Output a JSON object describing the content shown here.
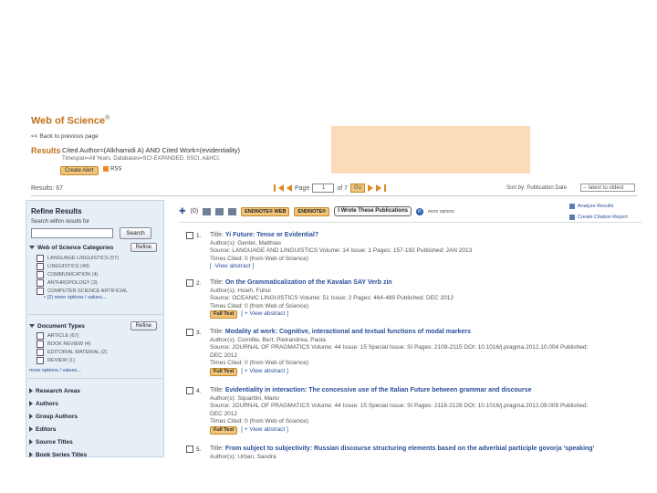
{
  "header": {
    "logo": "Web of Science",
    "logo_sup": "®",
    "back_link": "<< Back to previous page",
    "results_label": "Results",
    "query": "Cited Author=(Alkhamidi A) AND Cited Work=(evidentiality)",
    "query_sub": "Timespan=All Years. Databases=SCI-EXPANDED, SSCI, A&HCI.",
    "create_alert": "Create Alert",
    "rss": "RSS"
  },
  "toolbar_top": {
    "results_count": "Results: 67",
    "page_label": "Page",
    "page_value": "1",
    "page_of": "of 7",
    "go": "Go",
    "sort_by": "Sort by: Publication Date",
    "sort_value": "-- latest to oldest"
  },
  "refine": {
    "title": "Refine Results",
    "search_label": "Search within results for",
    "search_button": "Search",
    "refine_button": "Refine",
    "categories_title": "Web of Science Categories",
    "categories": [
      "LANGUAGE LINGUISTICS (57)",
      "LINGUISTICS (48)",
      "COMMUNICATION (4)",
      "ANTHROPOLOGY (3)",
      "COMPUTER SCIENCE ARTIFICIAL"
    ],
    "categories_more": "• (2) more options / values...",
    "doctypes_title": "Document Types",
    "doctypes": [
      "ARTICLE (67)",
      "BOOK REVIEW (4)",
      "EDITORIAL MATERIAL (2)",
      "REVIEW (1)"
    ],
    "doctypes_more": "more options / values...",
    "collapsed": [
      "Research Areas",
      "Authors",
      "Group Authors",
      "Editors",
      "Source Titles",
      "Book Series Titles"
    ]
  },
  "list_toolbar": {
    "count": "(0)",
    "endnote_web": "ENDNOTE® WEB",
    "endnote": "ENDNOTE®",
    "my_pubs": "I Wrote These Publications",
    "badge": "R",
    "more_options": "more options",
    "analyze": "Analyze Results",
    "citation_report": "Create Citation Report"
  },
  "records": [
    {
      "num": "1.",
      "title_prefix": "Title: ",
      "title": "Yi Future: Tense or Evidential?",
      "lines": [
        "Author(s): Genter, Matthias",
        "Source: LANGUAGE AND LINGUISTICS  Volume: 14  Issue: 1  Pages: 157-192  Published: JAN 2013",
        "Times Cited: 0  (from Web of Science)"
      ],
      "links": [
        "[ -View abstract ]"
      ]
    },
    {
      "num": "2.",
      "title_prefix": "Title: ",
      "title": "On the Grammaticalization of the Kavalan SAY Verb zin",
      "lines": [
        "Author(s): Hsieh, Fuhui",
        "Source: OCEANIC LINGUISTICS  Volume: 51  Issue: 2  Pages: 464-489  Published: DEC 2012",
        "Times Cited: 0  (from Web of Science)"
      ],
      "links": [
        "Full Text",
        "[ + View abstract ]"
      ]
    },
    {
      "num": "3.",
      "title_prefix": "Title: ",
      "title": "Modality at work: Cognitive, interactional and textual functions of modal markers",
      "lines": [
        "Author(s): Cornillie, Bert; Pietrandrea, Paola",
        "Source: JOURNAL OF PRAGMATICS  Volume: 44  Issue: 15  Special Issue: SI  Pages: 2109-2115  DOI: 10.1016/j.pragma.2012.10.004  Published:",
        "DEC 2012",
        "Times Cited: 0  (from Web of Science)"
      ],
      "links": [
        "Full Text",
        "[ + View abstract ]"
      ]
    },
    {
      "num": "4.",
      "title_prefix": "Title: ",
      "title": "Evidentiality in interaction: The concessive use of the Italian Future between grammar and discourse",
      "lines": [
        "Author(s): Squartini, Mario",
        "Source: JOURNAL OF PRAGMATICS  Volume: 44  Issue: 15  Special Issue: SI  Pages: 2116-2128  DOI: 10.1016/j.pragma.2012.09.009  Published:",
        "DEC 2012",
        "Times Cited: 0  (from Web of Science)"
      ],
      "links": [
        "Full Text",
        "[ + View abstract ]"
      ]
    },
    {
      "num": "5.",
      "title_prefix": "Title: ",
      "title": "From subject to subjectivity: Russian discourse structuring elements based on the adverbial participle govorja 'speaking'",
      "lines": [
        "Author(s): Urban, Sandra"
      ],
      "links": []
    }
  ]
}
